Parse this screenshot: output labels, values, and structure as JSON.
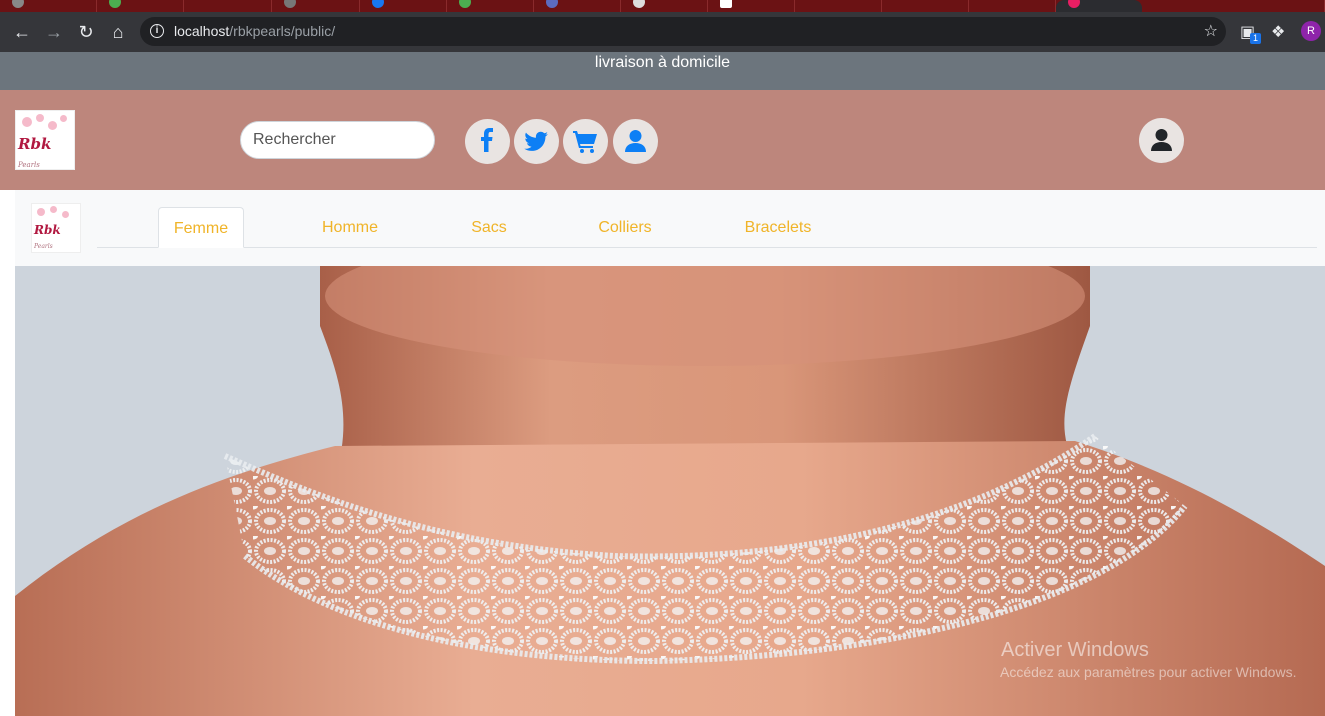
{
  "browser": {
    "url_host": "localhost",
    "url_path": "/rbkpearls/public/",
    "profile_initial": "R",
    "extension_badge": "1"
  },
  "topbar": {
    "text": "livraison à domicile"
  },
  "header": {
    "logo_text": "Rbk",
    "logo_subtext": "Pearls",
    "search_placeholder": "Rechercher",
    "icons": [
      "facebook-icon",
      "twitter-icon",
      "cart-icon",
      "user-icon"
    ],
    "account_icon": "user-icon"
  },
  "nav": {
    "tabs": [
      {
        "label": "Femme",
        "active": true
      },
      {
        "label": "Homme"
      },
      {
        "label": "Sacs"
      },
      {
        "label": "Colliers"
      },
      {
        "label": "Bracelets"
      }
    ]
  },
  "watermark": {
    "title": "Activer Windows",
    "subtitle": "Accédez aux paramètres pour activer Windows."
  },
  "colors": {
    "header_bg": "#bd867c",
    "topbar_bg": "#6c757d",
    "tab_text": "#f0b429",
    "icon_blue": "#0d7ff5"
  }
}
